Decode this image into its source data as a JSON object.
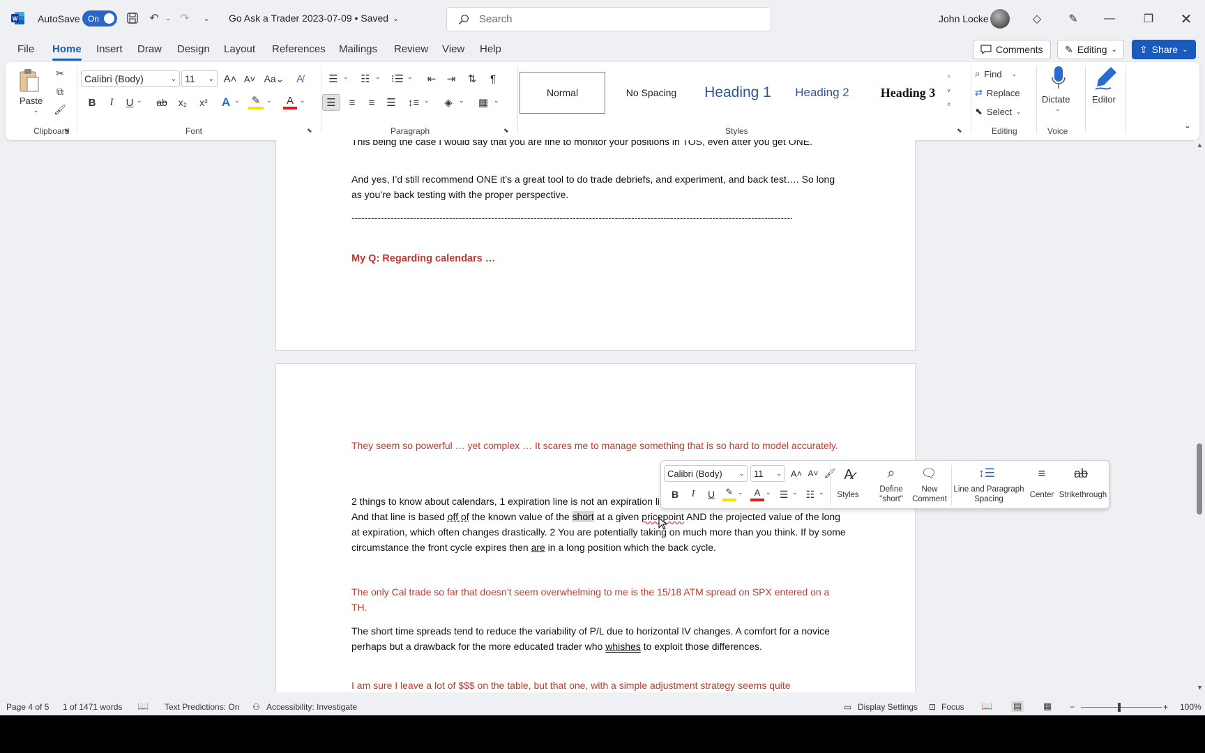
{
  "titlebar": {
    "autosave_label": "AutoSave",
    "autosave_state": "On",
    "doc_title": "Go Ask a Trader 2023-07-09 • Saved",
    "search_placeholder": "Search",
    "user_name": "John Locke"
  },
  "tabs": [
    "File",
    "Home",
    "Insert",
    "Draw",
    "Design",
    "Layout",
    "References",
    "Mailings",
    "Review",
    "View",
    "Help"
  ],
  "active_tab": "Home",
  "top_buttons": {
    "comments": "Comments",
    "editing": "Editing",
    "share": "Share"
  },
  "ribbon": {
    "clipboard": {
      "paste": "Paste",
      "label": "Clipboard"
    },
    "font": {
      "family": "Calibri (Body)",
      "size": "11",
      "label": "Font"
    },
    "paragraph": {
      "label": "Paragraph"
    },
    "styles": {
      "items": [
        "Normal",
        "No Spacing",
        "Heading 1",
        "Heading 2",
        "Heading 3"
      ],
      "label": "Styles"
    },
    "editing": {
      "find": "Find",
      "replace": "Replace",
      "select": "Select",
      "label": "Editing"
    },
    "voice": {
      "dictate": "Dictate",
      "label": "Voice"
    },
    "editor": {
      "label": "Editor"
    }
  },
  "document": {
    "page1": {
      "p0": "This being the case I would say that you are fine to monitor your positions in TOS, even after you get ONE.",
      "p1": "And yes, I’d still recommend ONE it’s a great tool to do trade debriefs, and experiment, and back test…. So long as you’re back testing with the proper perspective.",
      "dashes": "--------------------------------------------------------------------------------------------------------------------------------------------------------",
      "heading": "My Q: Regarding calendars …"
    },
    "page2": {
      "q1": "They seem so powerful … yet complex … It scares me to manage something that is so hard to model accurately.",
      "a1_part1": "2 things to know about calendars, 1 expiration line is not an expiration line… it is a T+ (DTE on short option) line…. And that line is based ",
      "a1_offof": "off of",
      "a1_part2": " the known value of the ",
      "a1_short": "short",
      "a1_part3": " at a given ",
      "a1_pricepoint": "pricepoint",
      "a1_part4": " AND the projected value of the long at expiration, which often changes drastically.   2 You are potentially taking on much more than you think. If by some circumstance the front cycle expires then ",
      "a1_are": "are",
      "a1_part5": " in a long position which the back cycle.",
      "q2": "The only Cal trade so far that doesn’t seem overwhelming to me is the 15/18 ATM spread on SPX entered on a TH.",
      "a2_part1": "The short time spreads tend to reduce the variability of P/L due to horizontal IV changes. A comfort for a novice perhaps but a drawback for the more educated trader who ",
      "a2_whishes": "whishes",
      "a2_part2": " to exploit those differences.",
      "q3": "I am sure I leave a lot of $$$ on the table, but that one, with a simple adjustment strategy seems quite"
    }
  },
  "mini_toolbar": {
    "font": "Calibri (Body)",
    "size": "11",
    "styles": "Styles",
    "define": "Define \"short\"",
    "new_comment": "New Comment",
    "line_spacing": "Line and Paragraph Spacing",
    "center": "Center",
    "strikethrough": "Strikethrough"
  },
  "statusbar": {
    "page": "Page 4 of 5",
    "words": "1 of 1471 words",
    "text_predictions": "Text Predictions: On",
    "accessibility": "Accessibility: Investigate",
    "display_settings": "Display Settings",
    "focus": "Focus",
    "zoom": "100%"
  },
  "colors": {
    "accent": "#185abd",
    "doc_red": "#c0392b"
  }
}
